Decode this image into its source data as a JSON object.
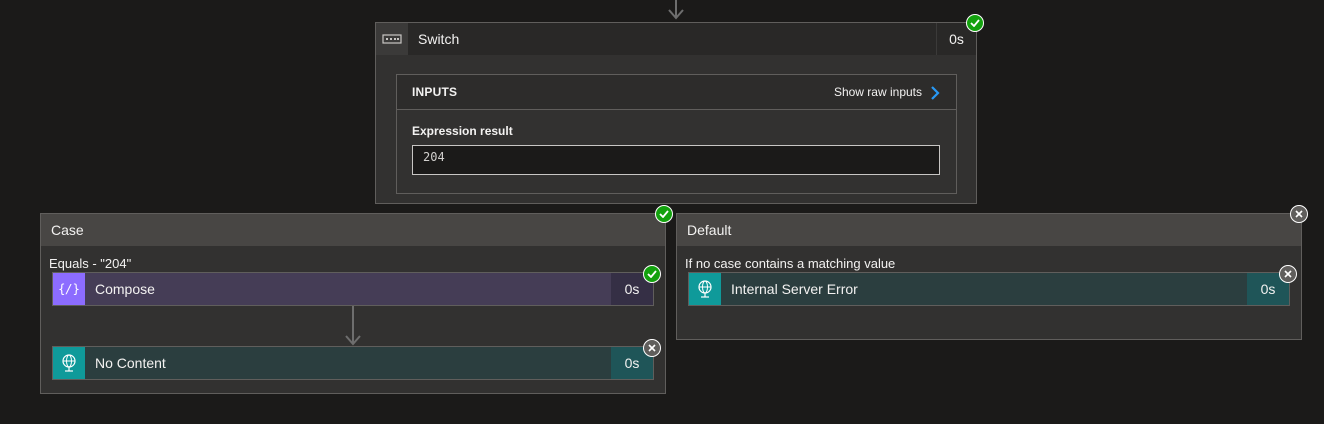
{
  "switch": {
    "title": "Switch",
    "duration": "0s",
    "status": "succeeded",
    "inputs": {
      "heading": "INPUTS",
      "raw_link": "Show raw inputs",
      "expression_label": "Expression result",
      "expression_value": "204"
    }
  },
  "case": {
    "title": "Case",
    "condition": "Equals - \"204\"",
    "status": "succeeded",
    "actions": [
      {
        "name": "Compose",
        "duration": "0s",
        "icon": "compose-icon",
        "status": "succeeded"
      },
      {
        "name": "No Content",
        "duration": "0s",
        "icon": "globe-icon",
        "status": "skipped"
      }
    ]
  },
  "default": {
    "title": "Default",
    "condition": "If no case contains a matching value",
    "status": "skipped",
    "actions": [
      {
        "name": "Internal Server Error",
        "duration": "0s",
        "icon": "globe-icon",
        "status": "skipped"
      }
    ]
  },
  "colors": {
    "background": "#1b1a19",
    "succeeded": "#13a10e",
    "skipped": "#605e5c",
    "compose_accent": "#8c6cff",
    "http_accent": "#0f9a9a",
    "link_chevron": "#2899f5"
  }
}
